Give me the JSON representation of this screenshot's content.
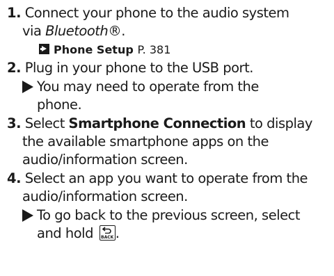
{
  "steps": [
    {
      "number": "1.",
      "line1": "Connect your phone to the audio system",
      "line2_prefix": "via ",
      "line2_italic": "Bluetooth",
      "line2_suffix": "®.",
      "reference": {
        "title": "Phone Setup",
        "page": "P. 381"
      }
    },
    {
      "number": "2.",
      "line1": "Plug in your phone to the USB port.",
      "note_line1": "You may need to operate from the",
      "note_line2": "phone."
    },
    {
      "number": "3.",
      "line1_prefix": "Select ",
      "line1_bold": "Smartphone Connection",
      "line1_suffix": " to display",
      "line2": "the available smartphone apps on the",
      "line3": "audio/information screen."
    },
    {
      "number": "4.",
      "line1": "Select an app you want to operate from the",
      "line2": "audio/information screen.",
      "note_line1": "To go back to the previous screen, select",
      "note_line2_prefix": "and hold",
      "note_line2_suffix": ".",
      "back_icon": "back-button-icon",
      "back_label": "BACK"
    }
  ],
  "icons": {
    "reference_arrow": "reference-arrow-icon",
    "note_bullet": "triangle-bullet-icon"
  }
}
